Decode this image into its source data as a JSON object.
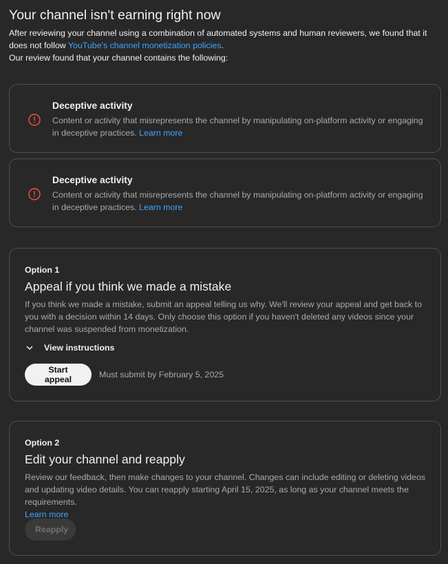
{
  "header": {
    "title": "Your channel isn't earning right now"
  },
  "intro": {
    "text_before_link": "After reviewing your channel using a combination of automated systems and human reviewers, we found that it does not follow ",
    "policy_link": "YouTube's channel monetization policies",
    "text_after_link": ".",
    "findings_text": "Our review found that your channel contains the following:"
  },
  "issues": [
    {
      "icon": "alert-circle-icon",
      "title": "Deceptive activity",
      "description": "Content or activity that misrepresents the channel by manipulating on-platform activity or engaging in deceptive practices. ",
      "learn_more": "Learn more"
    },
    {
      "icon": "alert-circle-icon",
      "title": "Deceptive activity",
      "description": "Content or activity that misrepresents the channel by manipulating on-platform activity or engaging in deceptive practices. ",
      "learn_more": "Learn more"
    }
  ],
  "option1": {
    "label": "Option 1",
    "title": "Appeal if you think we made a mistake",
    "description": "If you think we made a mistake, submit an appeal telling us why. We'll review your appeal and get back to you with a decision within 14 days. Only choose this option if you haven't deleted any videos since your channel was suspended from monetization.",
    "view_instructions": "View instructions",
    "button": "Start appeal",
    "deadline": "Must submit by February 5, 2025"
  },
  "option2": {
    "label": "Option 2",
    "title": "Edit your channel and reapply",
    "description": "Review our feedback, then make changes to your channel. Changes can include editing or deleting videos and updating video details. You can reapply starting April 15, 2025, as long as your channel meets the requirements.",
    "learn_more": "Learn more",
    "button": "Reapply"
  },
  "colors": {
    "background": "#282828",
    "link": "#3ea6ff",
    "alert": "#ff4e45",
    "border": "#4e4e4e"
  }
}
